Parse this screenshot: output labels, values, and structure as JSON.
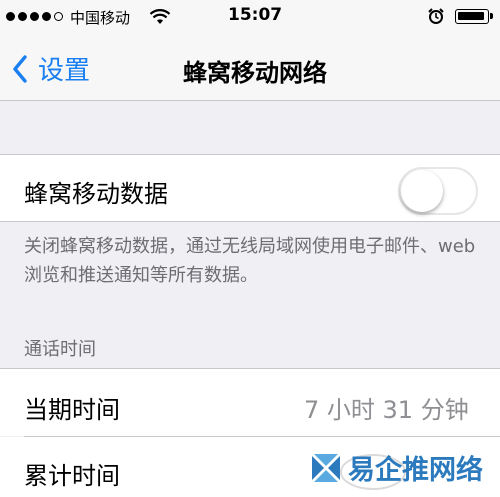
{
  "status_bar": {
    "signal_bars": 4,
    "carrier": "中国移动",
    "time": "15:07",
    "icons": [
      "signal-dots-icon",
      "wifi-icon",
      "alarm-icon",
      "battery-icon"
    ]
  },
  "nav": {
    "back_label": "设置",
    "title": "蜂窝移动网络"
  },
  "cellular_data": {
    "label": "蜂窝移动数据",
    "enabled": false,
    "footer": "关闭蜂窝移动数据，通过无线局域网使用电子邮件、web 浏览和推送通知等所有数据。"
  },
  "call_time": {
    "header": "通话时间",
    "rows": [
      {
        "label": "当期时间",
        "value": "7 小时 31 分钟"
      },
      {
        "label": "累计时间",
        "value": ""
      }
    ]
  },
  "watermark": {
    "text": "易企推网络"
  },
  "colors": {
    "accent": "#1a7ff0",
    "background": "#efeff4",
    "secondary_text": "#6d6d72",
    "watermark": "#1b6fb9"
  }
}
